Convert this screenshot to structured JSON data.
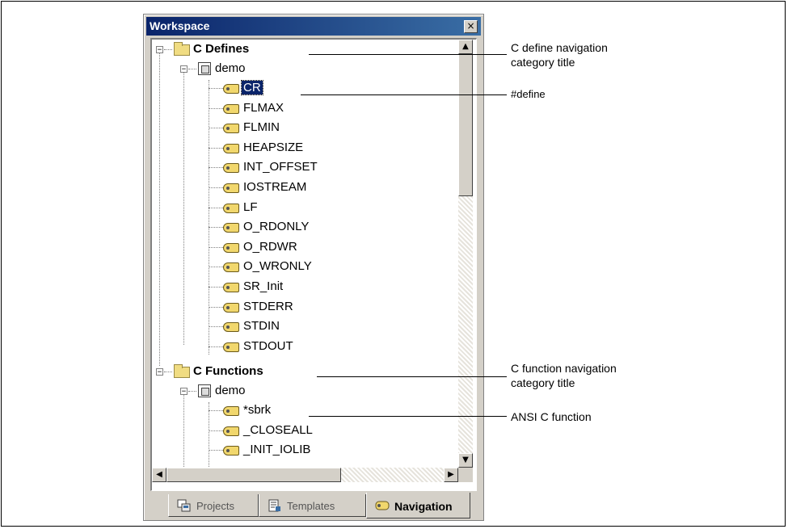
{
  "window": {
    "title": "Workspace",
    "close_label": "×"
  },
  "tree": {
    "defines_category": {
      "label": "C Defines",
      "expander": "−"
    },
    "defines_project": {
      "label": "demo",
      "expander": "−"
    },
    "defines": [
      "CR",
      "FLMAX",
      "FLMIN",
      "HEAPSIZE",
      "INT_OFFSET",
      "IOSTREAM",
      "LF",
      "O_RDONLY",
      "O_RDWR",
      "O_WRONLY",
      "SR_Init",
      "STDERR",
      "STDIN",
      "STDOUT"
    ],
    "selected_define": "CR",
    "functions_category": {
      "label": "C Functions",
      "expander": "−"
    },
    "functions_project": {
      "label": "demo",
      "expander": "−"
    },
    "functions": [
      "*sbrk",
      "_CLOSEALL",
      "_INIT_IOLIB"
    ]
  },
  "scrollbar": {
    "up": "▲",
    "down": "▼",
    "left": "◀",
    "right": "▶"
  },
  "tabs": [
    {
      "label": "Projects",
      "icon": "projects-icon",
      "active": false
    },
    {
      "label": "Templates",
      "icon": "templates-icon",
      "active": false
    },
    {
      "label": "Navigation",
      "icon": "navigation-icon",
      "active": true
    }
  ],
  "callouts": {
    "define_category": [
      "C define navigation",
      "category title"
    ],
    "define": [
      "#define"
    ],
    "function_category": [
      "C function navigation",
      "category title"
    ],
    "function": [
      "ANSI C function"
    ]
  },
  "colors": {
    "titlebar": "#0a246a",
    "selection": "#0a246a",
    "chrome": "#d4d0c8"
  }
}
